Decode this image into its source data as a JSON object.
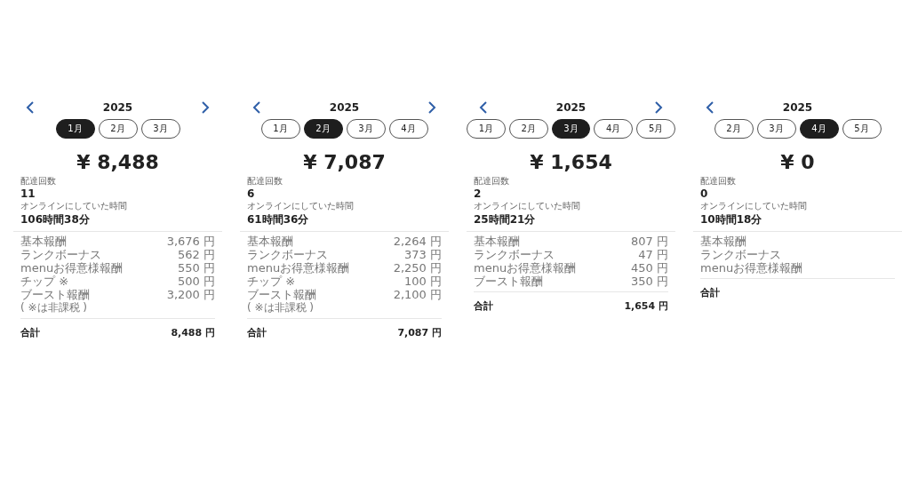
{
  "panels": [
    {
      "year": "2025",
      "next_arrow": true,
      "months": [
        {
          "label": "1月",
          "selected": true
        },
        {
          "label": "2月",
          "selected": false
        },
        {
          "label": "3月",
          "selected": false
        }
      ],
      "amount": "¥ 8,488",
      "delivery_label": "配達回数",
      "delivery_count": "11",
      "online_label": "オンラインにしていた時間",
      "online_time": "106時間38分",
      "items": [
        {
          "label": "基本報酬",
          "value": "3,676 円"
        },
        {
          "label": "ランクボーナス",
          "value": "562 円"
        },
        {
          "label": "menuお得意様報酬",
          "value": "550 円"
        },
        {
          "label": "チップ ※",
          "value": "500 円"
        },
        {
          "label": "ブースト報酬",
          "value": "3,200 円"
        }
      ],
      "note": "( ※は非課税 )",
      "total_label": "合計",
      "total_value": "8,488 円"
    },
    {
      "year": "2025",
      "next_arrow": true,
      "months": [
        {
          "label": "1月",
          "selected": false
        },
        {
          "label": "2月",
          "selected": true
        },
        {
          "label": "3月",
          "selected": false
        },
        {
          "label": "4月",
          "selected": false
        }
      ],
      "amount": "¥ 7,087",
      "delivery_label": "配達回数",
      "delivery_count": "6",
      "online_label": "オンラインにしていた時間",
      "online_time": "61時間36分",
      "items": [
        {
          "label": "基本報酬",
          "value": "2,264 円"
        },
        {
          "label": "ランクボーナス",
          "value": "373 円"
        },
        {
          "label": "menuお得意様報酬",
          "value": "2,250 円"
        },
        {
          "label": "チップ ※",
          "value": "100 円"
        },
        {
          "label": "ブースト報酬",
          "value": "2,100 円"
        }
      ],
      "note": "( ※は非課税 )",
      "total_label": "合計",
      "total_value": "7,087 円"
    },
    {
      "year": "2025",
      "next_arrow": true,
      "months": [
        {
          "label": "1月",
          "selected": false
        },
        {
          "label": "2月",
          "selected": false
        },
        {
          "label": "3月",
          "selected": true
        },
        {
          "label": "4月",
          "selected": false
        },
        {
          "label": "5月",
          "selected": false
        }
      ],
      "amount": "¥ 1,654",
      "delivery_label": "配達回数",
      "delivery_count": "2",
      "online_label": "オンラインにしていた時間",
      "online_time": "25時間21分",
      "items": [
        {
          "label": "基本報酬",
          "value": "807 円"
        },
        {
          "label": "ランクボーナス",
          "value": "47 円"
        },
        {
          "label": "menuお得意様報酬",
          "value": "450 円"
        },
        {
          "label": "ブースト報酬",
          "value": "350 円"
        }
      ],
      "total_label": "合計",
      "total_value": "1,654 円"
    },
    {
      "year": "2025",
      "next_arrow": false,
      "months": [
        {
          "label": "2月",
          "selected": false
        },
        {
          "label": "3月",
          "selected": false
        },
        {
          "label": "4月",
          "selected": true
        },
        {
          "label": "5月",
          "selected": false
        }
      ],
      "amount": "¥ 0",
      "delivery_label": "配達回数",
      "delivery_count": "0",
      "online_label": "オンラインにしていた時間",
      "online_time": "10時間18分",
      "items": [
        {
          "label": "基本報酬"
        },
        {
          "label": "ランクボーナス"
        },
        {
          "label": "menuお得意様報酬"
        }
      ],
      "total_label": "合計"
    }
  ]
}
